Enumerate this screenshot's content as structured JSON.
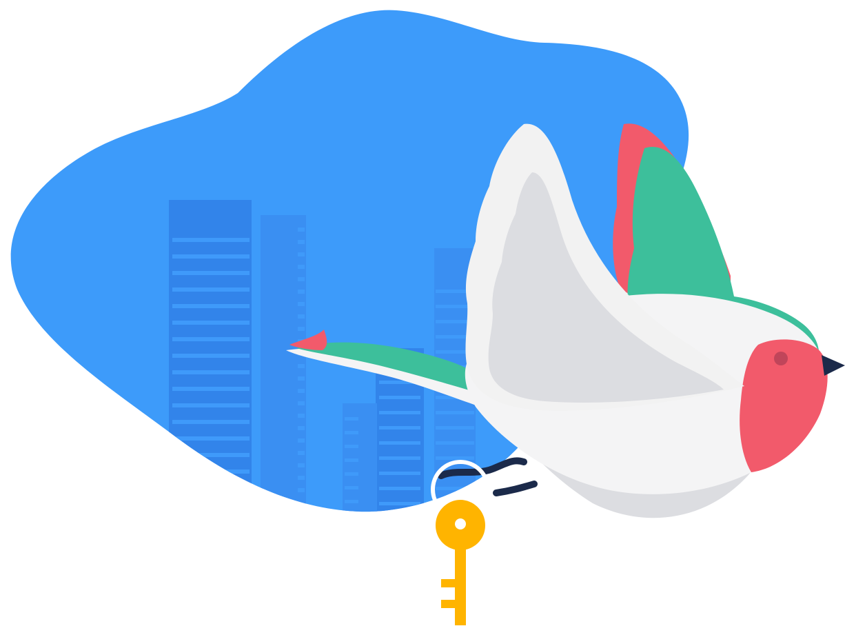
{
  "illustration": {
    "subject": "bird-carrying-key-over-city",
    "icons": [
      "blob-shape",
      "city-buildings",
      "bird-icon",
      "key-icon",
      "string-icon"
    ],
    "colors": {
      "background": "#ffffff",
      "blob": "#3d9bfa",
      "buildings_light": "#3a8ff2",
      "buildings_dark": "#3284ea",
      "building_windows": "#3f9afa",
      "wing_white": "#f2f2f2",
      "wing_grey": "#dcdde1",
      "body_white": "#f4f4f5",
      "body_shadow": "#dcdde1",
      "feather_green": "#3dbf9b",
      "feather_red": "#f25a6b",
      "head_red": "#f25a6b",
      "beak": "#1b2a4a",
      "eye": "#c0455a",
      "key_gold": "#ffb400",
      "ring": "#ffffff",
      "string_navy": "#1b2a4a"
    }
  }
}
